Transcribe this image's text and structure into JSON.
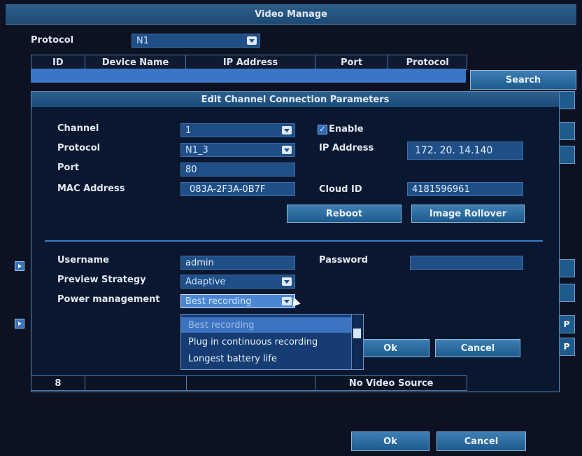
{
  "window": {
    "title": "Video Manage"
  },
  "top": {
    "protocol_label": "Protocol",
    "protocol_value": "N1",
    "columns": [
      "ID",
      "Device Name",
      "IP Address",
      "Port",
      "Protocol"
    ],
    "search_label": "Search"
  },
  "dialog": {
    "title": "Edit Channel Connection Parameters",
    "channel": {
      "label": "Channel",
      "value": "1"
    },
    "protocol": {
      "label": "Protocol",
      "value": "N1_3"
    },
    "port": {
      "label": "Port",
      "value": "80"
    },
    "mac": {
      "label": "MAC Address",
      "value": "083A-2F3A-0B7F"
    },
    "enable": {
      "label": "Enable",
      "checked": true
    },
    "ip": {
      "label": "IP Address",
      "value": "172. 20. 14.140"
    },
    "cloud": {
      "label": "Cloud ID",
      "value": "4181596961"
    },
    "reboot_label": "Reboot",
    "image_rollover_label": "Image Rollover",
    "username": {
      "label": "Username",
      "value": "admin"
    },
    "password": {
      "label": "Password",
      "value": ""
    },
    "preview": {
      "label": "Preview Strategy",
      "value": "Adaptive"
    },
    "power": {
      "label": "Power management",
      "value": "Best recording",
      "options": [
        "Best recording",
        "Plug in continuous recording",
        "Longest battery life"
      ]
    },
    "ok_label": "Ok",
    "cancel_label": "Cancel"
  },
  "bottom": {
    "row_id": "8",
    "row_status": "No Video Source",
    "ok_label": "Ok",
    "cancel_label": "Cancel"
  },
  "side_tiles": [
    "P",
    "P"
  ],
  "colors": {
    "accent": "#3a76c6",
    "title": "#1d4a72",
    "background": "#0d1222"
  }
}
